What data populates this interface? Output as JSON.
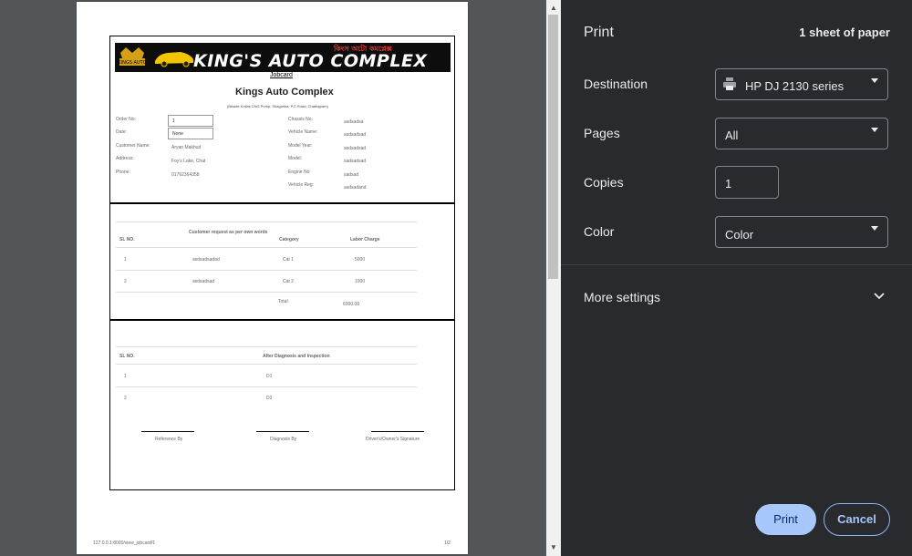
{
  "preview": {
    "banner": {
      "brand_text": "KING'S AUTO COMPLEX",
      "sub_text": "কিংস অটো কমপ্লেক্স",
      "logo_text": "KINGS AUTO"
    },
    "jobcard_label": "Jobcard",
    "company_name": "Kings Auto Complex",
    "company_address": "(Beside Kollas CNG Pump, Shagorika, P.C Road, Chattogram)",
    "left_fields": [
      {
        "label": "Order No:",
        "value": "1"
      },
      {
        "label": "Date:",
        "value": "None"
      },
      {
        "label": "Customer Name:",
        "value": "Aryan Makhud"
      },
      {
        "label": "Address:",
        "value": "Foy's Lake, Chat"
      },
      {
        "label": "Phone:",
        "value": "01762364358"
      }
    ],
    "right_fields": [
      {
        "label": "Chassis No:",
        "value": "asdsadsa"
      },
      {
        "label": "Vehicle Name:",
        "value": "asdsadsad"
      },
      {
        "label": "Model Year:",
        "value": "asdsadsad"
      },
      {
        "label": "Model:",
        "value": "sadsadsad"
      },
      {
        "label": "Engine No:",
        "value": "sadsad"
      },
      {
        "label": "Vehicle Reg:",
        "value": "asdsadand"
      }
    ],
    "requests_table": {
      "headers": [
        "SL NO.",
        "Customer request as per own words",
        "Category",
        "Labor Charge"
      ],
      "rows": [
        [
          "1",
          "asdsadsadad",
          "Cat 1",
          "5000"
        ],
        [
          "2",
          "asdsadsad",
          "Cat 2",
          "1000"
        ]
      ],
      "total_label": "Total:",
      "total_value": "6000.00"
    },
    "diagnosis_table": {
      "headers": [
        "SL NO.",
        "After Diagnosis and Inspection"
      ],
      "rows": [
        [
          "1",
          "D1"
        ],
        [
          "2",
          "D2"
        ]
      ]
    },
    "signatures": [
      "Reference By",
      "Diagnosis By",
      "Driver's/Owner's Signature"
    ],
    "footer_url": "127.0.0.1:8000/view_jobcard/1",
    "footer_page": "1/2"
  },
  "panel": {
    "title": "Print",
    "sheets": "1 sheet of paper",
    "destination_label": "Destination",
    "destination_value": "HP DJ 2130 series",
    "pages_label": "Pages",
    "pages_value": "All",
    "copies_label": "Copies",
    "copies_value": "1",
    "color_label": "Color",
    "color_value": "Color",
    "more_settings": "More settings",
    "print_button": "Print",
    "cancel_button": "Cancel"
  },
  "colors": {
    "panel_bg": "#292a2d",
    "preview_bg": "#525659",
    "accent": "#8ab4f8",
    "print_button_bg": "#a8c7fa",
    "print_button_text": "#062e6f"
  }
}
